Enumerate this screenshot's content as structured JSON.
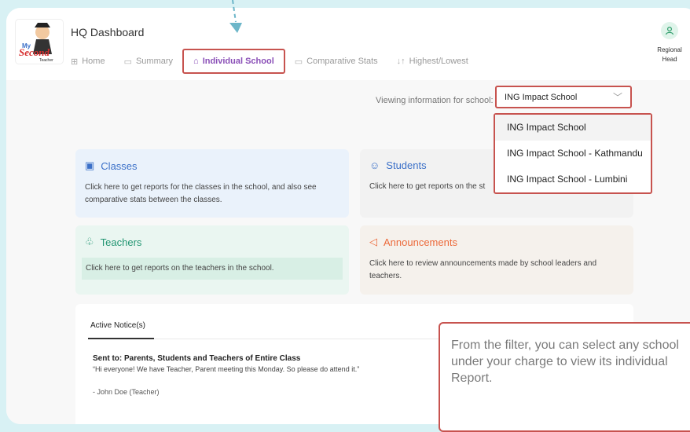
{
  "app": {
    "title": "HQ Dashboard"
  },
  "nav": [
    {
      "label": "Home",
      "icon": "grid-icon"
    },
    {
      "label": "Summary",
      "icon": "summary-icon"
    },
    {
      "label": "Individual School",
      "icon": "school-icon",
      "active": true
    },
    {
      "label": "Comparative Stats",
      "icon": "stats-icon"
    },
    {
      "label": "Highest/Lowest",
      "icon": "sort-icon"
    }
  ],
  "user": {
    "role": "Regional Head",
    "icon": "user-icon"
  },
  "filter": {
    "label": "Viewing information for school:",
    "selected": "ING Impact School",
    "options": [
      "ING Impact School",
      "ING Impact School - Kathmandu",
      "ING Impact School - Lumbini"
    ]
  },
  "cards": {
    "classes": {
      "title": "Classes",
      "desc": "Click here to get reports for the classes in the school, and also see comparative stats between the classes."
    },
    "students": {
      "title": "Students",
      "desc": "Click here to get reports on the st"
    },
    "teachers": {
      "title": "Teachers",
      "desc": "Click here to get reports on the teachers in the school."
    },
    "announcements": {
      "title": "Announcements",
      "desc": "Click here to review announcements made by school leaders and teachers."
    }
  },
  "notice": {
    "tab": "Active Notice(s)",
    "sent_to": "Sent to: Parents, Students and Teachers of Entire Class",
    "message": "“Hi everyone! We have Teacher, Parent meeting this Monday. So please do attend it.”",
    "author": "- John Doe (Teacher)"
  },
  "callout": {
    "text": "From the filter, you can select any school under your charge to view its individual Report."
  },
  "colors": {
    "accent": "#8a4fb7",
    "highlight": "#c7534f",
    "blue": "#3b70c8",
    "green": "#249673",
    "orange": "#ec6a3b"
  }
}
